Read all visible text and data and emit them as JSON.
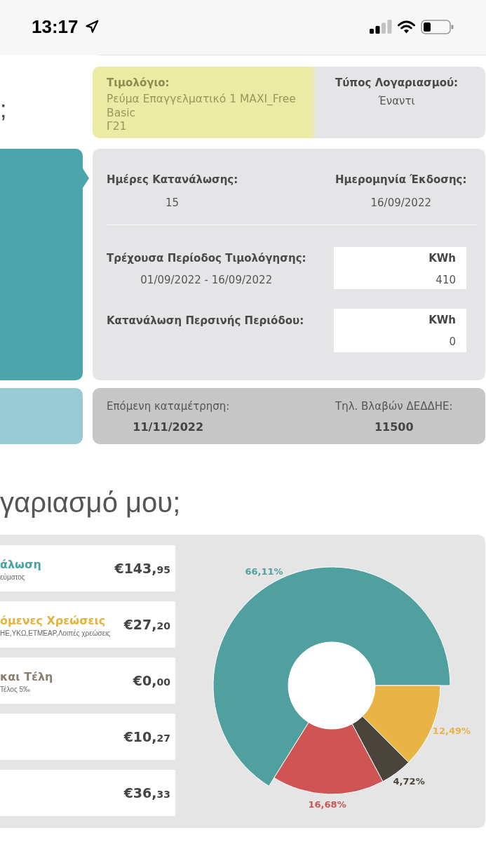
{
  "status_bar": {
    "time": "13:17"
  },
  "heading_fragment": ";",
  "account": {
    "tariff": {
      "label": "Τιμολόγιο:",
      "lines": [
        "Ρεύμα Επαγγελματικό 1 MAXI_Free Basic",
        "Γ21"
      ],
      "highlighted": true
    },
    "account_type": {
      "label": "Τύπος Λογαριασμού:",
      "value": "Έναντι"
    }
  },
  "consumption": {
    "days": {
      "label": "Ημέρες Κατανάλωσης:",
      "value": "15"
    },
    "issue_date": {
      "label": "Ημερομηνία Έκδοσης:",
      "value": "16/09/2022"
    },
    "current_period": {
      "label": "Τρέχουσα Περίοδος Τιμολόγησης:",
      "value": "01/09/2022 - 16/09/2022",
      "unit": "KWh",
      "amount": "410"
    },
    "last_year": {
      "label": "Κατανάλωση Περσινής Περιόδου:",
      "unit": "KWh",
      "amount": "0"
    }
  },
  "meter": {
    "next_reading": {
      "label": "Επόμενη καταμέτρηση:",
      "value": "11/11/2022"
    },
    "outage_phone": {
      "label": "Τηλ. Βλαβών ΔΕΔΔΗΕ:",
      "value": "11500"
    }
  },
  "breakdown": {
    "heading": "γαριασμό μου;",
    "items": [
      {
        "title": "άλωση",
        "subtitle": "εύματος",
        "color": "#4aa3a3",
        "amount_main": "€143,",
        "amount_cents": "95"
      },
      {
        "title": "όμενες Χρεώσεις",
        "subtitle": "ΗΕ,ΥΚΩ,ΕΤΜΕΑΡ,Λοιπές χρεώσεις",
        "color": "#e6b23e",
        "amount_main": "€27,",
        "amount_cents": "20"
      },
      {
        "title": "και Τέλη",
        "subtitle": "Τέλος 5‰",
        "color": "#8b7d70",
        "amount_main": "€0,",
        "amount_cents": "00"
      },
      {
        "amount_main": "€10,",
        "amount_cents": "27"
      },
      {
        "amount_main": "€36,",
        "amount_cents": "33"
      }
    ],
    "chart_slices": [
      {
        "exploded": true
      },
      {
        "exploded": false
      },
      {
        "exploded": false
      },
      {
        "exploded": false
      }
    ],
    "chart_data": {
      "type": "donut",
      "values": [
        66.11,
        12.49,
        4.72,
        16.68
      ],
      "colors": [
        "#50a0a0",
        "#e8b445",
        "#4b443c",
        "#cf5454"
      ],
      "value_labels": [
        "66,11%",
        "12,49%",
        "4,72%",
        "16,68%"
      ]
    }
  }
}
